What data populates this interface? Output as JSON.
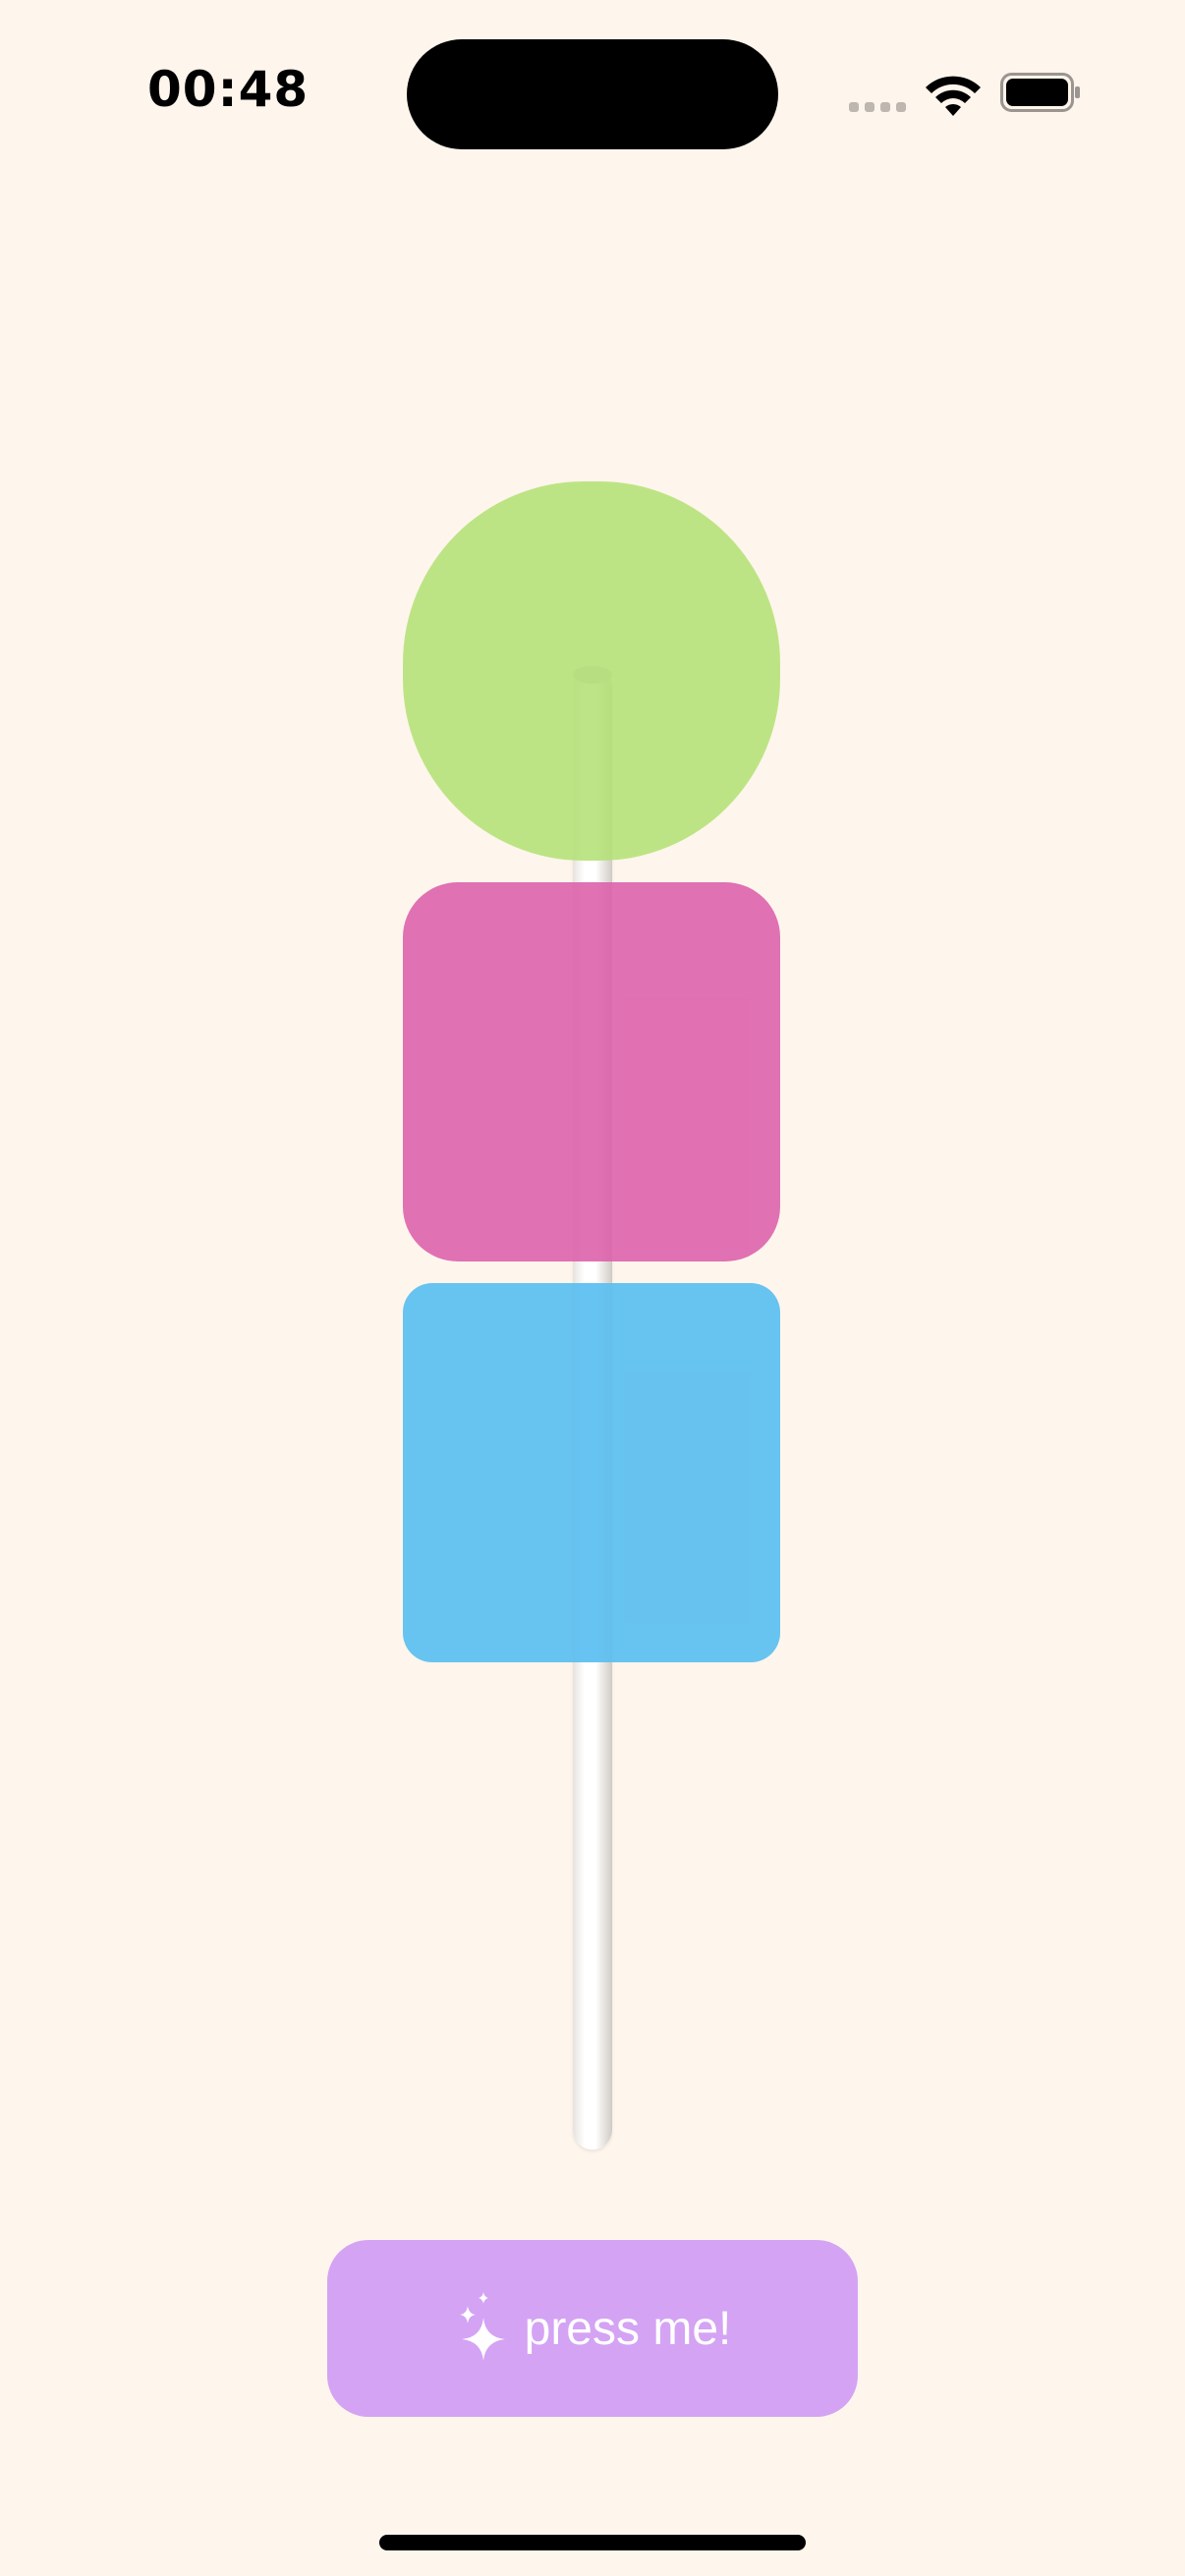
{
  "status_bar": {
    "time": "00:48",
    "signal_icon": "cellular-signal-icon",
    "wifi_icon": "wifi-icon",
    "battery_icon": "battery-icon",
    "battery_level": 1.0
  },
  "candies": [
    {
      "name": "green",
      "color": "#B2E172"
    },
    {
      "name": "pink",
      "color": "#DC5EAA"
    },
    {
      "name": "blue",
      "color": "#5ABEF0"
    }
  ],
  "button": {
    "label": "press me!",
    "icon": "sparkles-icon",
    "color": "#D4A3F3"
  },
  "background_color": "#FEF5EC"
}
